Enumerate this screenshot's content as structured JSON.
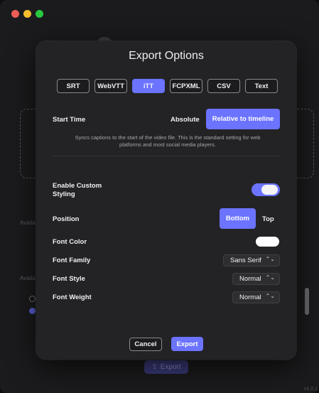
{
  "window": {
    "traffic_lights": [
      "close",
      "minimize",
      "zoom"
    ]
  },
  "background": {
    "labels": [
      "Availa",
      "Availa"
    ],
    "export_label": "Export",
    "version": "v1.0.1"
  },
  "dialog": {
    "title": "Export Options",
    "formats": [
      {
        "label": "SRT",
        "active": false
      },
      {
        "label": "WebVTT",
        "active": false
      },
      {
        "label": "iTT",
        "active": true
      },
      {
        "label": "FCPXML",
        "active": false
      },
      {
        "label": "CSV",
        "active": false
      },
      {
        "label": "Text",
        "active": false
      }
    ],
    "start_time": {
      "label": "Start Time",
      "options": [
        "Absolute",
        "Relative to timeline"
      ],
      "selected": "Relative to timeline",
      "note": "Syncs captions to the start of the video file. This is the standard setting for web platforms and most social media players."
    },
    "custom_styling": {
      "label": "Enable Custom Styling",
      "enabled": true
    },
    "position": {
      "label": "Position",
      "options": [
        "Bottom",
        "Top"
      ],
      "selected": "Bottom"
    },
    "font_color": {
      "label": "Font Color",
      "value": "#ffffff"
    },
    "font_family": {
      "label": "Font Family",
      "value": "Sans Serif"
    },
    "font_style": {
      "label": "Font Style",
      "value": "Normal"
    },
    "font_weight": {
      "label": "Font Weight",
      "value": "Normal"
    },
    "cancel_label": "Cancel",
    "export_label": "Export"
  },
  "colors": {
    "accent": "#6b73ff",
    "window_bg": "#1b1b1d",
    "dialog_bg": "#232325"
  }
}
